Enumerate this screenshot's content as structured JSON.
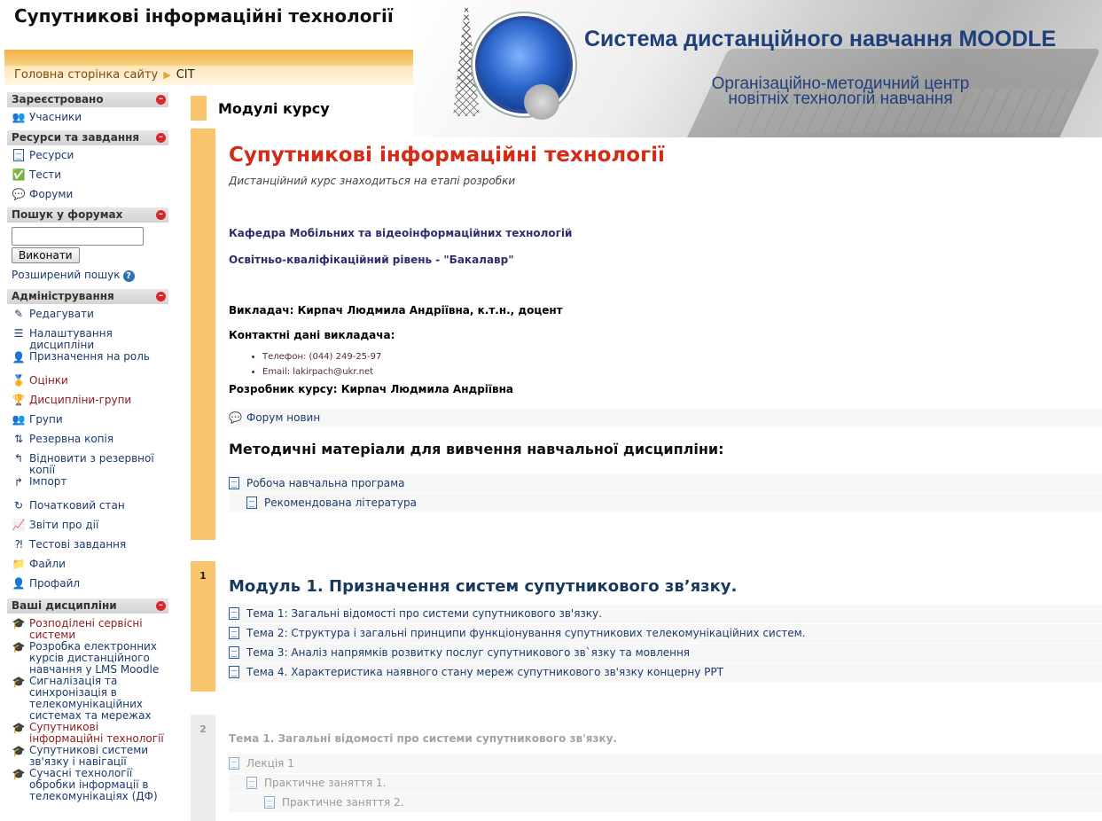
{
  "header": {
    "site_title": "Супутникові інформаційні технології",
    "moodle_title": "Система дистанційного навчання MOODLE",
    "center_title_line1": "Організаційно-методичний центр",
    "center_title_line2": "новітніх технологій навчання"
  },
  "breadcrumb": {
    "home": "Головна сторінка сайту",
    "current": "СІТ"
  },
  "sidebar": {
    "registered": {
      "title": "Зареєстровано",
      "items": [
        {
          "label": "Учасники",
          "icon": "users-icon"
        }
      ]
    },
    "resources": {
      "title": "Ресурси та завдання",
      "items": [
        {
          "label": "Ресурси",
          "icon": "page-icon"
        },
        {
          "label": "Тести",
          "icon": "quiz-icon"
        },
        {
          "label": "Форуми",
          "icon": "forum-icon"
        }
      ]
    },
    "forum_search": {
      "title": "Пошук у форумах",
      "button": "Виконати",
      "advanced": "Розширений пошук"
    },
    "admin": {
      "title": "Адміністрування",
      "items": [
        {
          "label": "Редагувати",
          "icon": "edit-icon"
        },
        {
          "label": "Налаштування дисципліни",
          "icon": "settings-icon"
        },
        {
          "label": "Призначення на роль",
          "icon": "roles-icon"
        },
        {
          "label": "Оцінки",
          "icon": "grades-icon"
        },
        {
          "label": "Дисципліни-групи",
          "icon": "meta-course-icon"
        },
        {
          "label": "Групи",
          "icon": "groups-icon"
        },
        {
          "label": "Резервна копія",
          "icon": "backup-icon"
        },
        {
          "label": "Відновити з резервної копії",
          "icon": "restore-icon"
        },
        {
          "label": "Імпорт",
          "icon": "import-icon"
        },
        {
          "label": "Початковий стан",
          "icon": "reset-icon"
        },
        {
          "label": "Звіти про дії",
          "icon": "reports-icon"
        },
        {
          "label": "Тестові завдання",
          "icon": "questions-icon"
        },
        {
          "label": "Файли",
          "icon": "files-icon"
        },
        {
          "label": "Профайл",
          "icon": "profile-icon"
        }
      ]
    },
    "my_courses": {
      "title": "Ваші дисципліни",
      "items": [
        {
          "label": "Розподілені сервісні системи"
        },
        {
          "label": "Розробка електронних курсів дистанційного навчання у LMS Moodle"
        },
        {
          "label": "Сигналізація та синхронізація в телекомунікаційних системах та мережах"
        },
        {
          "label": "Супутникові інформаційні технології"
        },
        {
          "label": "Супутникові системи зв'язку і навігації"
        },
        {
          "label": "Сучасні технології обробки інформації в телекомунікаціях (ДФ)"
        }
      ]
    }
  },
  "main": {
    "modules_title": "Модулі курсу",
    "section0": {
      "course_title": "Супутникові інформаційні технології",
      "subtitle": "Дистанційний курс знаходиться на етапі розробки",
      "department": "Кафедра Мобільних та відеоінформаційних технологій",
      "level": "Освітньо-кваліфікаційний рівень - \"Бакалавр\"",
      "teacher": "Викладач: Кирпач Людмила Андріївна, к.т.н., доцент",
      "contacts_heading": "Контактні дані викладача:",
      "phone": "Телефон: (044) 249-25-97",
      "email": "Email: lakirpach@ukr.net",
      "author": "Розробник курсу: Кирпач Людмила Андріївна",
      "forum_news": "Форум новин",
      "materials_heading": "Методичні матеріали для вивчення навчальної дисципліни:",
      "materials": [
        "Робоча навчальна програма",
        "Рекомендована література"
      ]
    },
    "section1": {
      "number": "1",
      "title": "Модуль 1. Призначення систем супутникового зв’язку.",
      "topics": [
        "Тема 1: Загальні відомості про системи супутникового зв'язку.",
        "Тема 2: Структура і загальні принципи функціонування супутникових телекомунікаційних систем.",
        "Тема 3: Аналіз напрямків розвитку послуг супутникового зв`язку та мовлення",
        "Тема 4. Характеристика наявного стану мереж супутникового зв'язку концерну РРТ"
      ]
    },
    "section2": {
      "number": "2",
      "title": "Тема 1. Загальні відомості про системи супутникового зв'язку.",
      "items": [
        "Лекція 1",
        "Практичне заняття 1.",
        "Практичне заняття 2."
      ]
    }
  },
  "colors": {
    "accent_orange": "#f9c46c",
    "course_title_red": "#d42b17",
    "link_blue": "#1b3a6b",
    "module_title": "#17395e"
  }
}
